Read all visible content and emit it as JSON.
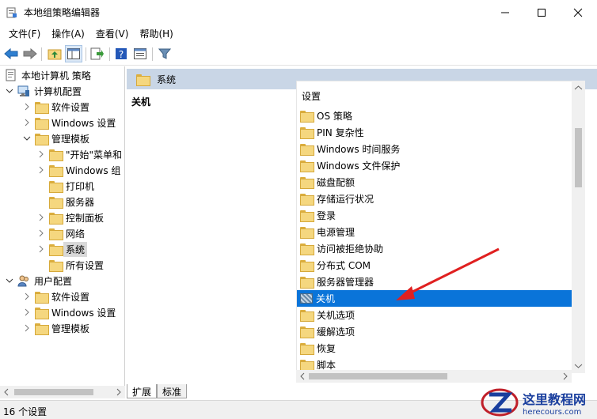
{
  "window": {
    "title": "本地组策略编辑器"
  },
  "menu": [
    "文件(F)",
    "操作(A)",
    "查看(V)",
    "帮助(H)"
  ],
  "tree": {
    "root": "本地计算机 策略",
    "computer": "计算机配置",
    "computer_children": [
      "软件设置",
      "Windows 设置",
      "管理模板"
    ],
    "admin_children": [
      "\"开始\"菜单和",
      "Windows 组",
      "打印机",
      "服务器",
      "控制面板",
      "网络",
      "系统",
      "所有设置"
    ],
    "user": "用户配置",
    "user_children": [
      "软件设置",
      "Windows 设置",
      "管理模板"
    ]
  },
  "right": {
    "header": "系统",
    "desc_title": "关机",
    "column_header": "设置",
    "items": [
      "OS 策略",
      "PIN 复杂性",
      "Windows 时间服务",
      "Windows 文件保护",
      "磁盘配额",
      "存储运行状况",
      "登录",
      "电源管理",
      "访问被拒绝协助",
      "分布式 COM",
      "服务器管理器",
      "关机",
      "关机选项",
      "缓解选项",
      "恢复",
      "脚本"
    ],
    "selected_item": "关机"
  },
  "tabs": [
    "扩展",
    "标准"
  ],
  "status": "16 个设置",
  "watermark": {
    "title": "这里教程网",
    "url": "herecours.com"
  },
  "colors": {
    "selection": "#0a74d9",
    "header_band": "#c9d6e6",
    "arrow": "#e02020"
  }
}
